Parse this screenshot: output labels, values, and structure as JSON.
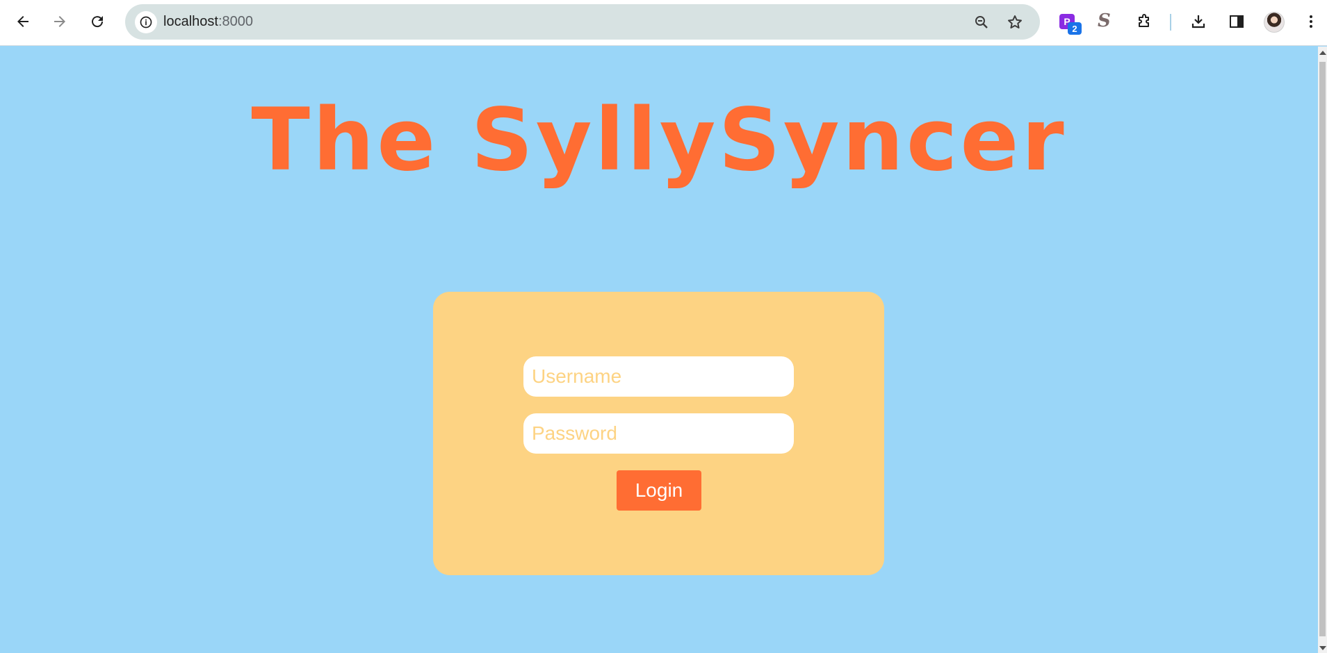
{
  "browser": {
    "url_host": "localhost",
    "url_port": ":8000",
    "extensions": {
      "p_letter": "P",
      "p_badge": "2",
      "s_letter": "S"
    },
    "icons": [
      "back-icon",
      "forward-icon",
      "reload-icon",
      "site-info-icon",
      "zoom-icon",
      "bookmark-star-icon",
      "extensions-puzzle-icon",
      "download-icon",
      "side-panel-icon",
      "profile-avatar",
      "more-menu-icon"
    ]
  },
  "page": {
    "title": "The SyllySyncer",
    "form": {
      "username_placeholder": "Username",
      "password_placeholder": "Password",
      "login_label": "Login"
    }
  },
  "colors": {
    "page_background": "#9ad6f8",
    "title_color": "#ff6d33",
    "card_background": "#fdd383",
    "button_background": "#ff6d33",
    "placeholder_color": "#fdd383"
  }
}
